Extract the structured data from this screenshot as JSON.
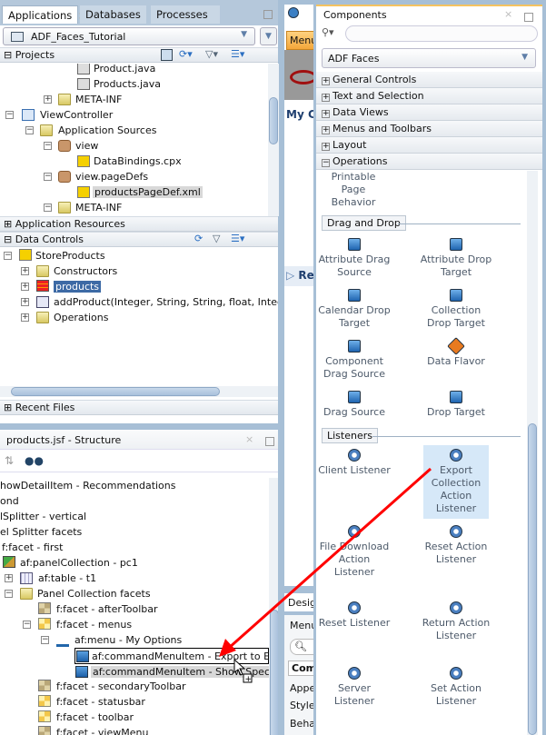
{
  "left_tabs": [
    "Applications",
    "Databases",
    "Processes"
  ],
  "app_selector": "ADF_Faces_Tutorial",
  "projects": {
    "title": "Projects",
    "items": [
      {
        "label": "Product.java"
      },
      {
        "label": "Products.java"
      },
      {
        "label": "META-INF"
      },
      {
        "label": "ViewController"
      },
      {
        "label": "Application Sources"
      },
      {
        "label": "view"
      },
      {
        "label": "DataBindings.cpx"
      },
      {
        "label": "view.pageDefs"
      },
      {
        "label": "productsPageDef.xml",
        "selected": true
      },
      {
        "label": "META-INF"
      }
    ]
  },
  "app_resources": "Application Resources",
  "data_controls": {
    "title": "Data Controls",
    "items": [
      {
        "label": "StoreProducts"
      },
      {
        "label": "Constructors"
      },
      {
        "label": "products",
        "selected": true
      },
      {
        "label": "addProduct(Integer, String, String, float, Integer, In"
      },
      {
        "label": "Operations"
      }
    ]
  },
  "recent_files": "Recent Files",
  "structure": {
    "title": "products.jsf - Structure",
    "items": [
      {
        "label": "howDetailItem - Recommendations"
      },
      {
        "label": "ond"
      },
      {
        "label": "lSplitter - vertical"
      },
      {
        "label": "el Splitter facets"
      },
      {
        "label": "f:facet - first"
      },
      {
        "label": "af:panelCollection - pc1"
      },
      {
        "label": "af:table - t1"
      },
      {
        "label": "Panel Collection facets"
      },
      {
        "label": "f:facet - afterToolbar"
      },
      {
        "label": "f:facet - menus"
      },
      {
        "label": "af:menu - My Options"
      },
      {
        "label": "af:commandMenuItem - Export to Excel",
        "drop_target": true
      },
      {
        "label": "af:commandMenuItem - Show Specials",
        "selected": true
      },
      {
        "label": "f:facet - secondaryToolbar"
      },
      {
        "label": "f:facet - statusbar"
      },
      {
        "label": "f:facet - toolbar"
      },
      {
        "label": "f:facet - viewMenu"
      }
    ]
  },
  "editor": {
    "tab_label": "Menu",
    "heading": "My C",
    "section": "Re",
    "bottom_tab": "Desig",
    "prop_title": "Menu",
    "prop_tab": "Com",
    "props": [
      "Appe",
      "Style",
      "Beha"
    ]
  },
  "components": {
    "title": "Components",
    "search_placeholder": "",
    "library": "ADF Faces",
    "categories": [
      {
        "label": "General Controls",
        "expanded": false
      },
      {
        "label": "Text and Selection",
        "expanded": false
      },
      {
        "label": "Data Views",
        "expanded": false
      },
      {
        "label": "Menus and Toolbars",
        "expanded": false
      },
      {
        "label": "Layout",
        "expanded": false
      },
      {
        "label": "Operations",
        "expanded": true
      }
    ],
    "printable": "Printable Page Behavior",
    "groups": [
      {
        "label": "Drag and Drop",
        "items": [
          "Attribute Drag Source",
          "Attribute Drop Target",
          "Calendar Drop Target",
          "Collection Drop Target",
          "Component Drag Source",
          "Data Flavor",
          "Drag Source",
          "Drop Target"
        ]
      },
      {
        "label": "Listeners",
        "items": [
          "Client Listener",
          "Export Collection Action Listener",
          "File Download Action Listener",
          "Reset Action Listener",
          "Reset Listener",
          "Return Action Listener",
          "Server Listener",
          "Set Action Listener"
        ]
      }
    ],
    "highlighted": "Export Collection Action Listener"
  },
  "colors": {
    "accent": "#3d6aa5",
    "arrow": "#ff0000",
    "highlight": "#d6e8f8"
  }
}
